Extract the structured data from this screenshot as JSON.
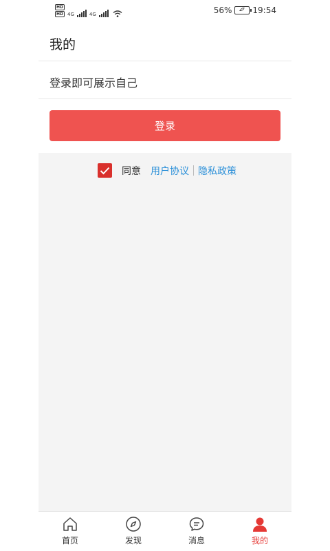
{
  "status_bar": {
    "hd1": "HD",
    "hd2": "HD",
    "net1": "4G",
    "net2": "4G",
    "battery": "56%",
    "time": "19:54"
  },
  "header": {
    "title": "我的"
  },
  "profile": {
    "prompt": "登录即可展示自己"
  },
  "login_button": {
    "label": "登录"
  },
  "agreement": {
    "agree_label": "同意",
    "checked": true,
    "user_agreement": "用户协议",
    "privacy_policy": "隐私政策",
    "link_color": "#2a8fd8",
    "check_color": "#d9302c"
  },
  "bottom_nav": {
    "active_color": "#e53935",
    "items": [
      {
        "label": "首页",
        "icon": "home-icon"
      },
      {
        "label": "发现",
        "icon": "compass-icon"
      },
      {
        "label": "消息",
        "icon": "message-icon"
      },
      {
        "label": "我的",
        "icon": "person-icon",
        "active": true
      }
    ]
  }
}
